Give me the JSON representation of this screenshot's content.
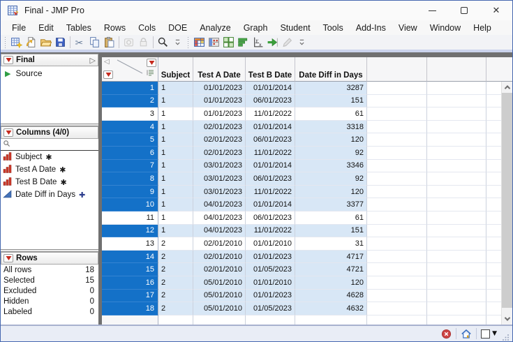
{
  "window": {
    "title": "Final - JMP Pro",
    "controls": {
      "minimize": "",
      "maximize": "",
      "close": "✕"
    }
  },
  "menu_bar": {
    "items": [
      "File",
      "Edit",
      "Tables",
      "Rows",
      "Cols",
      "DOE",
      "Analyze",
      "Graph",
      "Student",
      "Tools",
      "Add-Ins",
      "View",
      "Window",
      "Help"
    ]
  },
  "toolbar": {
    "groups": [
      {
        "icons": [
          "new-data-table",
          "new-journal",
          "open-folder",
          "save",
          "|",
          "cut",
          "copy",
          "paste",
          "|",
          "link",
          "lock",
          "|",
          "search",
          "overflow"
        ]
      },
      {
        "icons": [
          "data-table",
          "formula",
          "tile-windows",
          "distribution",
          "fit-y-by-x",
          "fit-model",
          "annotate",
          "overflow"
        ]
      }
    ],
    "disabled_icons": [
      "link",
      "lock",
      "annotate"
    ]
  },
  "sidebar": {
    "table_panel": {
      "title": "Final",
      "items": [
        {
          "label": "Source"
        }
      ]
    },
    "columns_panel": {
      "title": "Columns (4/0)",
      "search_value": "",
      "items": [
        {
          "label": "Subject",
          "type": "nominal",
          "modifier": "asterisk"
        },
        {
          "label": "Test A Date",
          "type": "nominal",
          "modifier": "asterisk"
        },
        {
          "label": "Test B Date",
          "type": "nominal",
          "modifier": "asterisk"
        },
        {
          "label": "Date Diff in Days",
          "type": "continuous",
          "modifier": "formula"
        }
      ]
    },
    "rows_panel": {
      "title": "Rows",
      "stats": [
        {
          "label": "All rows",
          "value": "18"
        },
        {
          "label": "Selected",
          "value": "15"
        },
        {
          "label": "Excluded",
          "value": "0"
        },
        {
          "label": "Hidden",
          "value": "0"
        },
        {
          "label": "Labeled",
          "value": "0"
        }
      ]
    }
  },
  "table": {
    "columns": [
      "Subject",
      "Test A Date",
      "Test B Date",
      "Date Diff in Days"
    ],
    "rows": [
      {
        "n": "1",
        "selected": true,
        "cells": [
          "1",
          "01/01/2023",
          "01/01/2014",
          "3287"
        ]
      },
      {
        "n": "2",
        "selected": true,
        "cells": [
          "1",
          "01/01/2023",
          "06/01/2023",
          "151"
        ]
      },
      {
        "n": "3",
        "selected": false,
        "cells": [
          "1",
          "01/01/2023",
          "11/01/2022",
          "61"
        ]
      },
      {
        "n": "4",
        "selected": true,
        "cells": [
          "1",
          "02/01/2023",
          "01/01/2014",
          "3318"
        ]
      },
      {
        "n": "5",
        "selected": true,
        "cells": [
          "1",
          "02/01/2023",
          "06/01/2023",
          "120"
        ]
      },
      {
        "n": "6",
        "selected": true,
        "cells": [
          "1",
          "02/01/2023",
          "11/01/2022",
          "92"
        ]
      },
      {
        "n": "7",
        "selected": true,
        "cells": [
          "1",
          "03/01/2023",
          "01/01/2014",
          "3346"
        ]
      },
      {
        "n": "8",
        "selected": true,
        "cells": [
          "1",
          "03/01/2023",
          "06/01/2023",
          "92"
        ]
      },
      {
        "n": "9",
        "selected": true,
        "cells": [
          "1",
          "03/01/2023",
          "11/01/2022",
          "120"
        ]
      },
      {
        "n": "10",
        "selected": true,
        "cells": [
          "1",
          "04/01/2023",
          "01/01/2014",
          "3377"
        ]
      },
      {
        "n": "11",
        "selected": false,
        "cells": [
          "1",
          "04/01/2023",
          "06/01/2023",
          "61"
        ]
      },
      {
        "n": "12",
        "selected": true,
        "cells": [
          "1",
          "04/01/2023",
          "11/01/2022",
          "151"
        ]
      },
      {
        "n": "13",
        "selected": false,
        "cells": [
          "2",
          "02/01/2010",
          "01/01/2010",
          "31"
        ]
      },
      {
        "n": "14",
        "selected": true,
        "cells": [
          "2",
          "02/01/2010",
          "01/01/2023",
          "4717"
        ]
      },
      {
        "n": "15",
        "selected": true,
        "cells": [
          "2",
          "02/01/2010",
          "01/05/2023",
          "4721"
        ]
      },
      {
        "n": "16",
        "selected": true,
        "cells": [
          "2",
          "05/01/2010",
          "01/01/2010",
          "120"
        ]
      },
      {
        "n": "17",
        "selected": true,
        "cells": [
          "2",
          "05/01/2010",
          "01/01/2023",
          "4628"
        ]
      },
      {
        "n": "18",
        "selected": true,
        "cells": [
          "2",
          "05/01/2010",
          "01/05/2023",
          "4632"
        ]
      }
    ]
  },
  "status_bar": {
    "icons": [
      "error",
      "home",
      "window-selector"
    ]
  },
  "colors": {
    "selection_blue": "#1471C8",
    "selected_cell": "#D8E7F6",
    "accent_border": "#4668B0",
    "splitter_gray": "#707070",
    "statusbar_bg": "#E9EDF6"
  }
}
